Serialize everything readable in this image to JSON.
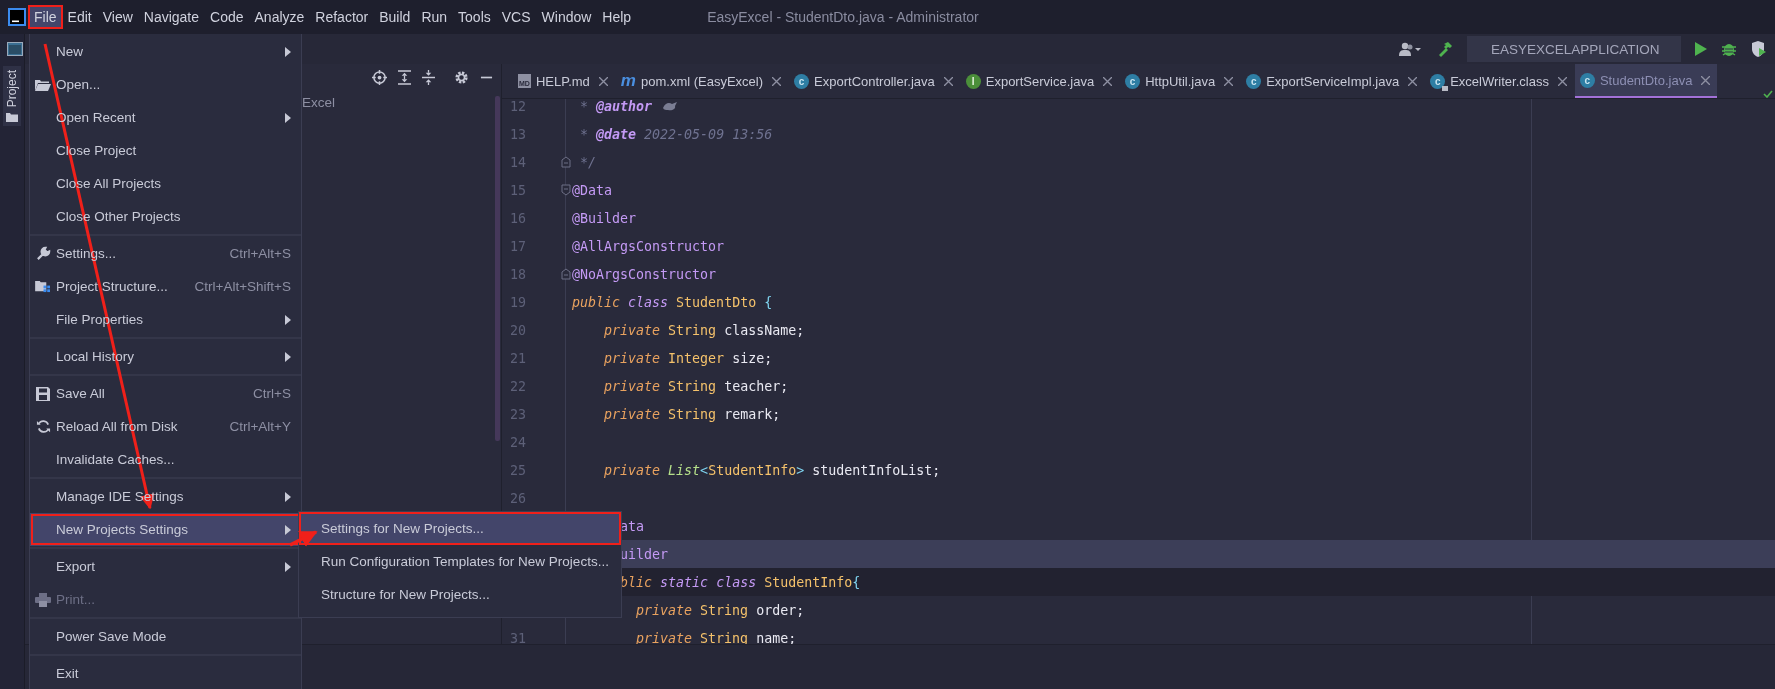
{
  "menubar": {
    "items": [
      {
        "label": "File",
        "selected": true
      },
      {
        "label": "Edit",
        "selected": false
      },
      {
        "label": "View",
        "selected": false
      },
      {
        "label": "Navigate",
        "selected": false
      },
      {
        "label": "Code",
        "selected": false
      },
      {
        "label": "Analyze",
        "selected": false
      },
      {
        "label": "Refactor",
        "selected": false
      },
      {
        "label": "Build",
        "selected": false
      },
      {
        "label": "Run",
        "selected": false
      },
      {
        "label": "Tools",
        "selected": false
      },
      {
        "label": "VCS",
        "selected": false
      },
      {
        "label": "Window",
        "selected": false
      },
      {
        "label": "Help",
        "selected": false
      }
    ],
    "title": "EasyExcel - StudentDto.java - Administrator"
  },
  "left_strip": {
    "tab": "Project"
  },
  "run_toolbar": {
    "configuration": "EASYEXCELAPPLICATION"
  },
  "project_panel": {
    "row": "Excel"
  },
  "tabs": [
    {
      "label": "HELP.md",
      "kind": "markdown",
      "badge": "MD",
      "selected": false
    },
    {
      "label": "pom.xml (EasyExcel)",
      "kind": "maven",
      "badge": "m",
      "selected": false
    },
    {
      "label": "ExportController.java",
      "kind": "class",
      "badge": "c",
      "selected": false
    },
    {
      "label": "ExportService.java",
      "kind": "interface",
      "badge": "I",
      "selected": false
    },
    {
      "label": "HttpUtil.java",
      "kind": "class",
      "badge": "c",
      "selected": false
    },
    {
      "label": "ExportServiceImpl.java",
      "kind": "class",
      "badge": "c",
      "selected": false
    },
    {
      "label": "ExcelWriter.class",
      "kind": "locked",
      "badge": "c",
      "selected": false
    },
    {
      "label": "StudentDto.java",
      "kind": "class",
      "badge": "c",
      "selected": true
    }
  ],
  "code": [
    {
      "number": "12",
      "kind": "plain",
      "current": false,
      "shaded": false,
      "tokens": [
        {
          "kind": "comment",
          "text": " * "
        },
        {
          "kind": "doc_tag",
          "text": "@author "
        },
        {
          "kind": "smudge"
        }
      ]
    },
    {
      "number": "13",
      "kind": "plain",
      "current": false,
      "shaded": false,
      "tokens": [
        {
          "kind": "comment",
          "text": " * "
        },
        {
          "kind": "doc_tag",
          "text": "@date "
        },
        {
          "kind": "comment",
          "text": "2022-05-09 13:56"
        }
      ]
    },
    {
      "number": "14",
      "kind": "fold_end",
      "current": false,
      "shaded": false,
      "tokens": [
        {
          "kind": "comment",
          "text": " */"
        }
      ]
    },
    {
      "number": "15",
      "kind": "fold_start",
      "current": false,
      "shaded": false,
      "tokens": [
        {
          "kind": "annotation",
          "text": "@Data"
        }
      ]
    },
    {
      "number": "16",
      "kind": "plain",
      "current": false,
      "shaded": false,
      "tokens": [
        {
          "kind": "annotation",
          "text": "@Builder"
        }
      ]
    },
    {
      "number": "17",
      "kind": "plain",
      "current": false,
      "shaded": false,
      "tokens": [
        {
          "kind": "annotation",
          "text": "@AllArgsConstructor"
        }
      ]
    },
    {
      "number": "18",
      "kind": "fold_end",
      "current": false,
      "shaded": false,
      "tokens": [
        {
          "kind": "annotation",
          "text": "@NoArgsConstructor"
        }
      ]
    },
    {
      "number": "19",
      "kind": "plain",
      "current": false,
      "shaded": false,
      "tokens": [
        {
          "kind": "keyword",
          "text": "public "
        },
        {
          "kind": "keyword2",
          "text": "class "
        },
        {
          "kind": "type",
          "text": "StudentDto "
        },
        {
          "kind": "brace",
          "text": "{"
        }
      ]
    },
    {
      "number": "20",
      "kind": "plain",
      "current": false,
      "shaded": false,
      "tokens": [
        {
          "kind": "keyword",
          "text": "    private "
        },
        {
          "kind": "type",
          "text": "String "
        },
        {
          "kind": "ident",
          "text": "className;"
        }
      ]
    },
    {
      "number": "21",
      "kind": "plain",
      "current": false,
      "shaded": false,
      "tokens": [
        {
          "kind": "keyword",
          "text": "    private "
        },
        {
          "kind": "type",
          "text": "Integer "
        },
        {
          "kind": "ident",
          "text": "size;"
        }
      ]
    },
    {
      "number": "22",
      "kind": "plain",
      "current": false,
      "shaded": false,
      "tokens": [
        {
          "kind": "keyword",
          "text": "    private "
        },
        {
          "kind": "type",
          "text": "String "
        },
        {
          "kind": "ident",
          "text": "teacher;"
        }
      ]
    },
    {
      "number": "23",
      "kind": "plain",
      "current": false,
      "shaded": false,
      "tokens": [
        {
          "kind": "keyword",
          "text": "    private "
        },
        {
          "kind": "type",
          "text": "String "
        },
        {
          "kind": "ident",
          "text": "remark;"
        }
      ]
    },
    {
      "number": "24",
      "kind": "plain",
      "current": false,
      "shaded": false
    },
    {
      "number": "25",
      "kind": "plain",
      "current": false,
      "shaded": false,
      "tokens": [
        {
          "kind": "keyword",
          "text": "    private "
        },
        {
          "kind": "generic",
          "text": "List"
        },
        {
          "kind": "brace",
          "text": "<"
        },
        {
          "kind": "type",
          "text": "StudentInfo"
        },
        {
          "kind": "brace",
          "text": "> "
        },
        {
          "kind": "ident",
          "text": "studentInfoList;"
        }
      ]
    },
    {
      "number": "26",
      "kind": "plain",
      "current": false,
      "shaded": false
    },
    {
      "kind": "plain",
      "current": false,
      "shaded": false,
      "tokens": [
        {
          "kind": "annotation",
          "text": "      ata"
        }
      ]
    },
    {
      "kind": "plain",
      "current": true,
      "shaded": false,
      "tokens": [
        {
          "kind": "annotation",
          "text": "      uilder"
        }
      ]
    },
    {
      "kind": "plain",
      "current": false,
      "shaded": true,
      "tokens": [
        {
          "kind": "keyword",
          "text": "      blic "
        },
        {
          "kind": "keyword2",
          "text": "static "
        },
        {
          "kind": "keyword2",
          "text": "class "
        },
        {
          "kind": "type",
          "text": "StudentInfo"
        },
        {
          "kind": "brace",
          "text": "{"
        }
      ]
    },
    {
      "kind": "plain",
      "current": false,
      "shaded": false,
      "tokens": [
        {
          "kind": "keyword",
          "text": "        private "
        },
        {
          "kind": "type",
          "text": "String "
        },
        {
          "kind": "ident",
          "text": "order;"
        }
      ]
    },
    {
      "number": "31",
      "kind": "plain",
      "current": false,
      "shaded": false,
      "tokens": [
        {
          "kind": "keyword",
          "text": "        private "
        },
        {
          "kind": "type",
          "text": "String "
        },
        {
          "kind": "ident",
          "text": "name;"
        }
      ]
    }
  ],
  "file_menu": {
    "groups": [
      {
        "items": [
          {
            "label": "New",
            "kind": "plain",
            "submenu": true,
            "selected": false,
            "disabled": false
          },
          {
            "label": "Open...",
            "kind": "open",
            "submenu": false,
            "selected": false,
            "disabled": false
          },
          {
            "label": "Open Recent",
            "kind": "plain",
            "submenu": true,
            "selected": false,
            "disabled": false
          },
          {
            "label": "Close Project",
            "kind": "plain",
            "submenu": false,
            "selected": false,
            "disabled": false
          },
          {
            "label": "Close All Projects",
            "kind": "plain",
            "submenu": false,
            "selected": false,
            "disabled": false
          },
          {
            "label": "Close Other Projects",
            "kind": "plain",
            "submenu": false,
            "selected": false,
            "disabled": false
          }
        ]
      },
      {
        "items": [
          {
            "label": "Settings...",
            "kind": "settings",
            "shortcut": "Ctrl+Alt+S",
            "submenu": false,
            "selected": false,
            "disabled": false
          },
          {
            "label": "Project Structure...",
            "kind": "structure",
            "shortcut": "Ctrl+Alt+Shift+S",
            "submenu": false,
            "selected": false,
            "disabled": false
          },
          {
            "label": "File Properties",
            "kind": "plain",
            "submenu": true,
            "selected": false,
            "disabled": false
          }
        ]
      },
      {
        "items": [
          {
            "label": "Local History",
            "kind": "plain",
            "submenu": true,
            "selected": false,
            "disabled": false
          }
        ]
      },
      {
        "items": [
          {
            "label": "Save All",
            "kind": "save",
            "shortcut": "Ctrl+S",
            "submenu": false,
            "selected": false,
            "disabled": false
          },
          {
            "label": "Reload All from Disk",
            "kind": "reload",
            "shortcut": "Ctrl+Alt+Y",
            "submenu": false,
            "selected": false,
            "disabled": false
          },
          {
            "label": "Invalidate Caches...",
            "kind": "plain",
            "submenu": false,
            "selected": false,
            "disabled": false
          }
        ]
      },
      {
        "items": [
          {
            "label": "Manage IDE Settings",
            "kind": "plain",
            "submenu": true,
            "selected": false,
            "disabled": false
          },
          {
            "label": "New Projects Settings",
            "kind": "plain",
            "submenu": true,
            "selected": true,
            "disabled": false
          }
        ]
      },
      {
        "items": [
          {
            "label": "Export",
            "kind": "plain",
            "submenu": true,
            "selected": false,
            "disabled": false
          },
          {
            "label": "Print...",
            "kind": "print",
            "submenu": false,
            "selected": false,
            "disabled": true
          }
        ]
      },
      {
        "items": [
          {
            "label": "Power Save Mode",
            "kind": "plain",
            "submenu": false,
            "selected": false,
            "disabled": false
          }
        ]
      },
      {
        "items": [
          {
            "label": "Exit",
            "kind": "plain",
            "submenu": false,
            "selected": false,
            "disabled": false
          }
        ]
      }
    ]
  },
  "submenu": {
    "items": [
      {
        "label": "Settings for New Projects...",
        "selected": true
      },
      {
        "label": "Run Configuration Templates for New Projects...",
        "selected": false
      },
      {
        "label": "Structure for New Projects...",
        "selected": false
      }
    ]
  }
}
